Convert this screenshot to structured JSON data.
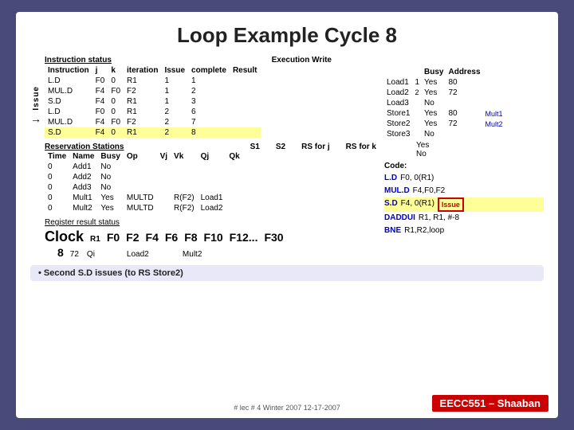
{
  "title": "Loop Example Cycle 8",
  "instruction_status": {
    "label": "Instruction status",
    "exec_header": "Execution Write",
    "columns": [
      "Instruction",
      "j",
      "k",
      "iteration",
      "Issue",
      "complete",
      "Result"
    ],
    "rows": [
      [
        "L.D",
        "F0",
        "0",
        "R1",
        "1",
        "1",
        "",
        ""
      ],
      [
        "MUL.D",
        "F4",
        "F0",
        "F2",
        "1",
        "2",
        "",
        ""
      ],
      [
        "S.D",
        "F4",
        "0",
        "R1",
        "1",
        "3",
        "",
        ""
      ],
      [
        "L.D",
        "F0",
        "0",
        "R1",
        "2",
        "6",
        "",
        ""
      ],
      [
        "MUL.D",
        "F4",
        "F0",
        "F2",
        "2",
        "7",
        "",
        ""
      ],
      [
        "S.D",
        "F4",
        "0",
        "R1",
        "2",
        "8",
        "",
        ""
      ]
    ]
  },
  "reservation_stations": {
    "label": "Reservation Stations",
    "extra_headers": [
      "S1",
      "S2",
      "RS for j",
      "RS for k"
    ],
    "sub_headers": [
      "Vj",
      "Vk",
      "Qj",
      "Qk"
    ],
    "columns": [
      "Time",
      "Name",
      "Busy",
      "Op"
    ],
    "rows": [
      [
        "0",
        "Add1",
        "No",
        "",
        "",
        "",
        "",
        ""
      ],
      [
        "0",
        "Add2",
        "No",
        "",
        "",
        "",
        "",
        ""
      ],
      [
        "0",
        "Add3",
        "No",
        "",
        "",
        "",
        "",
        ""
      ],
      [
        "0",
        "Mult1",
        "Yes",
        "MULTD",
        "R(F2)",
        "",
        "Load1",
        ""
      ],
      [
        "0",
        "Mult2",
        "Yes",
        "MULTD",
        "R(F2)",
        "",
        "Load2",
        ""
      ]
    ]
  },
  "busy_address": {
    "label": "Busy Address",
    "columns": [
      "",
      "Busy",
      "Address"
    ],
    "rows": [
      [
        "Load1",
        "1",
        "Yes",
        "80"
      ],
      [
        "Load2",
        "2",
        "Yes",
        "72"
      ],
      [
        "Load3",
        "",
        "No",
        ""
      ],
      [
        "Store1",
        "",
        "Yes",
        "80"
      ],
      [
        "Store2",
        "",
        "Yes",
        "72"
      ],
      [
        "Store3",
        "",
        "No",
        ""
      ]
    ]
  },
  "yes_no_label": "Yes No",
  "code": {
    "label": "Code:",
    "lines": [
      {
        "instr": "L.D",
        "ops": "F0, 0(R1)"
      },
      {
        "instr": "MUL.D",
        "ops": "F4,F0,F2"
      },
      {
        "instr": "S.D",
        "ops": "F4, 0(R1)",
        "highlight": true
      },
      {
        "instr": "DADDUI",
        "ops": "R1, R1, #-8"
      },
      {
        "instr": "BNE",
        "ops": "R1,R2,loop"
      }
    ]
  },
  "issue_label": "Issue",
  "register_status": {
    "label": "Register result status",
    "clock_label": "Clock",
    "r1_label": "R1",
    "f0_label": "F0",
    "f2_label": "F2",
    "f4_label": "F4",
    "f6_label": "F6",
    "f8_label": "F8",
    "f10_label": "F10",
    "f12_label": "F12...",
    "f30_label": "F30",
    "clock_val": "8",
    "r1_val": "72",
    "qi_label": "Qi",
    "f0_val": "",
    "f2_val": "Load2",
    "f4_val": "",
    "f6_val": "Mult2",
    "f8_val": "",
    "f10_val": "",
    "f12_val": ""
  },
  "bullet": "• Second  S.D issues  (to RS Store2)",
  "eecc": "EECC551 – Shaaban",
  "footer": "# lec # 4  Winter 2007   12-17-2007"
}
